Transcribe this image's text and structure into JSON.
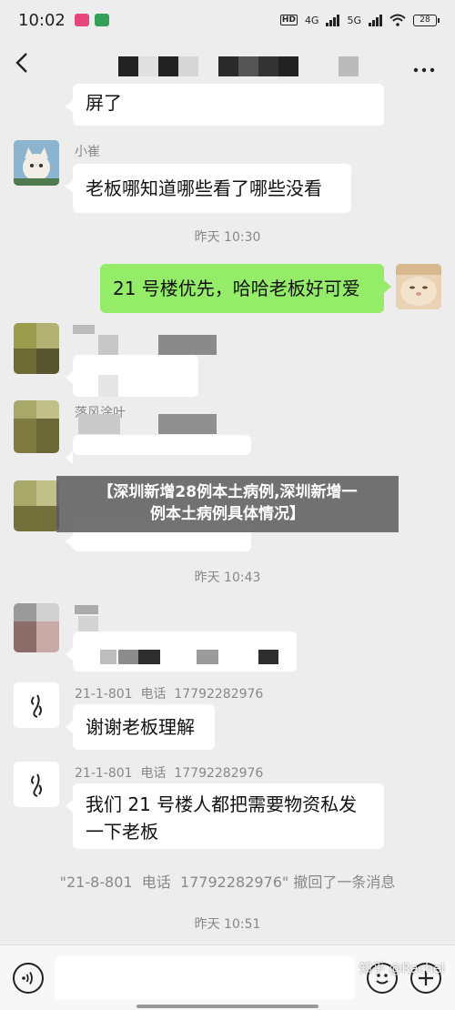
{
  "status_bar": {
    "time": "10:02",
    "network_1": "4G",
    "network_2": "5G",
    "battery": "28"
  },
  "messages": {
    "top_partial": "屏了",
    "m1_sender": "小崔",
    "m1_text": "老板哪知道哪些看了哪些没看",
    "time1": "昨天 10:30",
    "m2_text": "21 号楼优先，哈哈老板好可爱",
    "m4_sender": "落风涂叶",
    "time2": "昨天 10:43",
    "m7_sender": "21-1-801  电话  17792282976",
    "m7_text": "谢谢老板理解",
    "m8_sender": "21-1-801  电话  17792282976",
    "m8_text": "我们 21 号楼人都把需要物资私发一下老板",
    "recall": "\"21-8-801  电话  17792282976\" 撤回了一条消息",
    "time3": "昨天 10:51"
  },
  "overlay": {
    "line1": "【深圳新增28例本土病例,深圳新增一",
    "line2": "例本土病例具体情况】"
  },
  "watermark": "知乎 @Rachel",
  "colors": {
    "background": "#ededed",
    "self_bubble": "#95ec69",
    "other_bubble": "#ffffff"
  }
}
